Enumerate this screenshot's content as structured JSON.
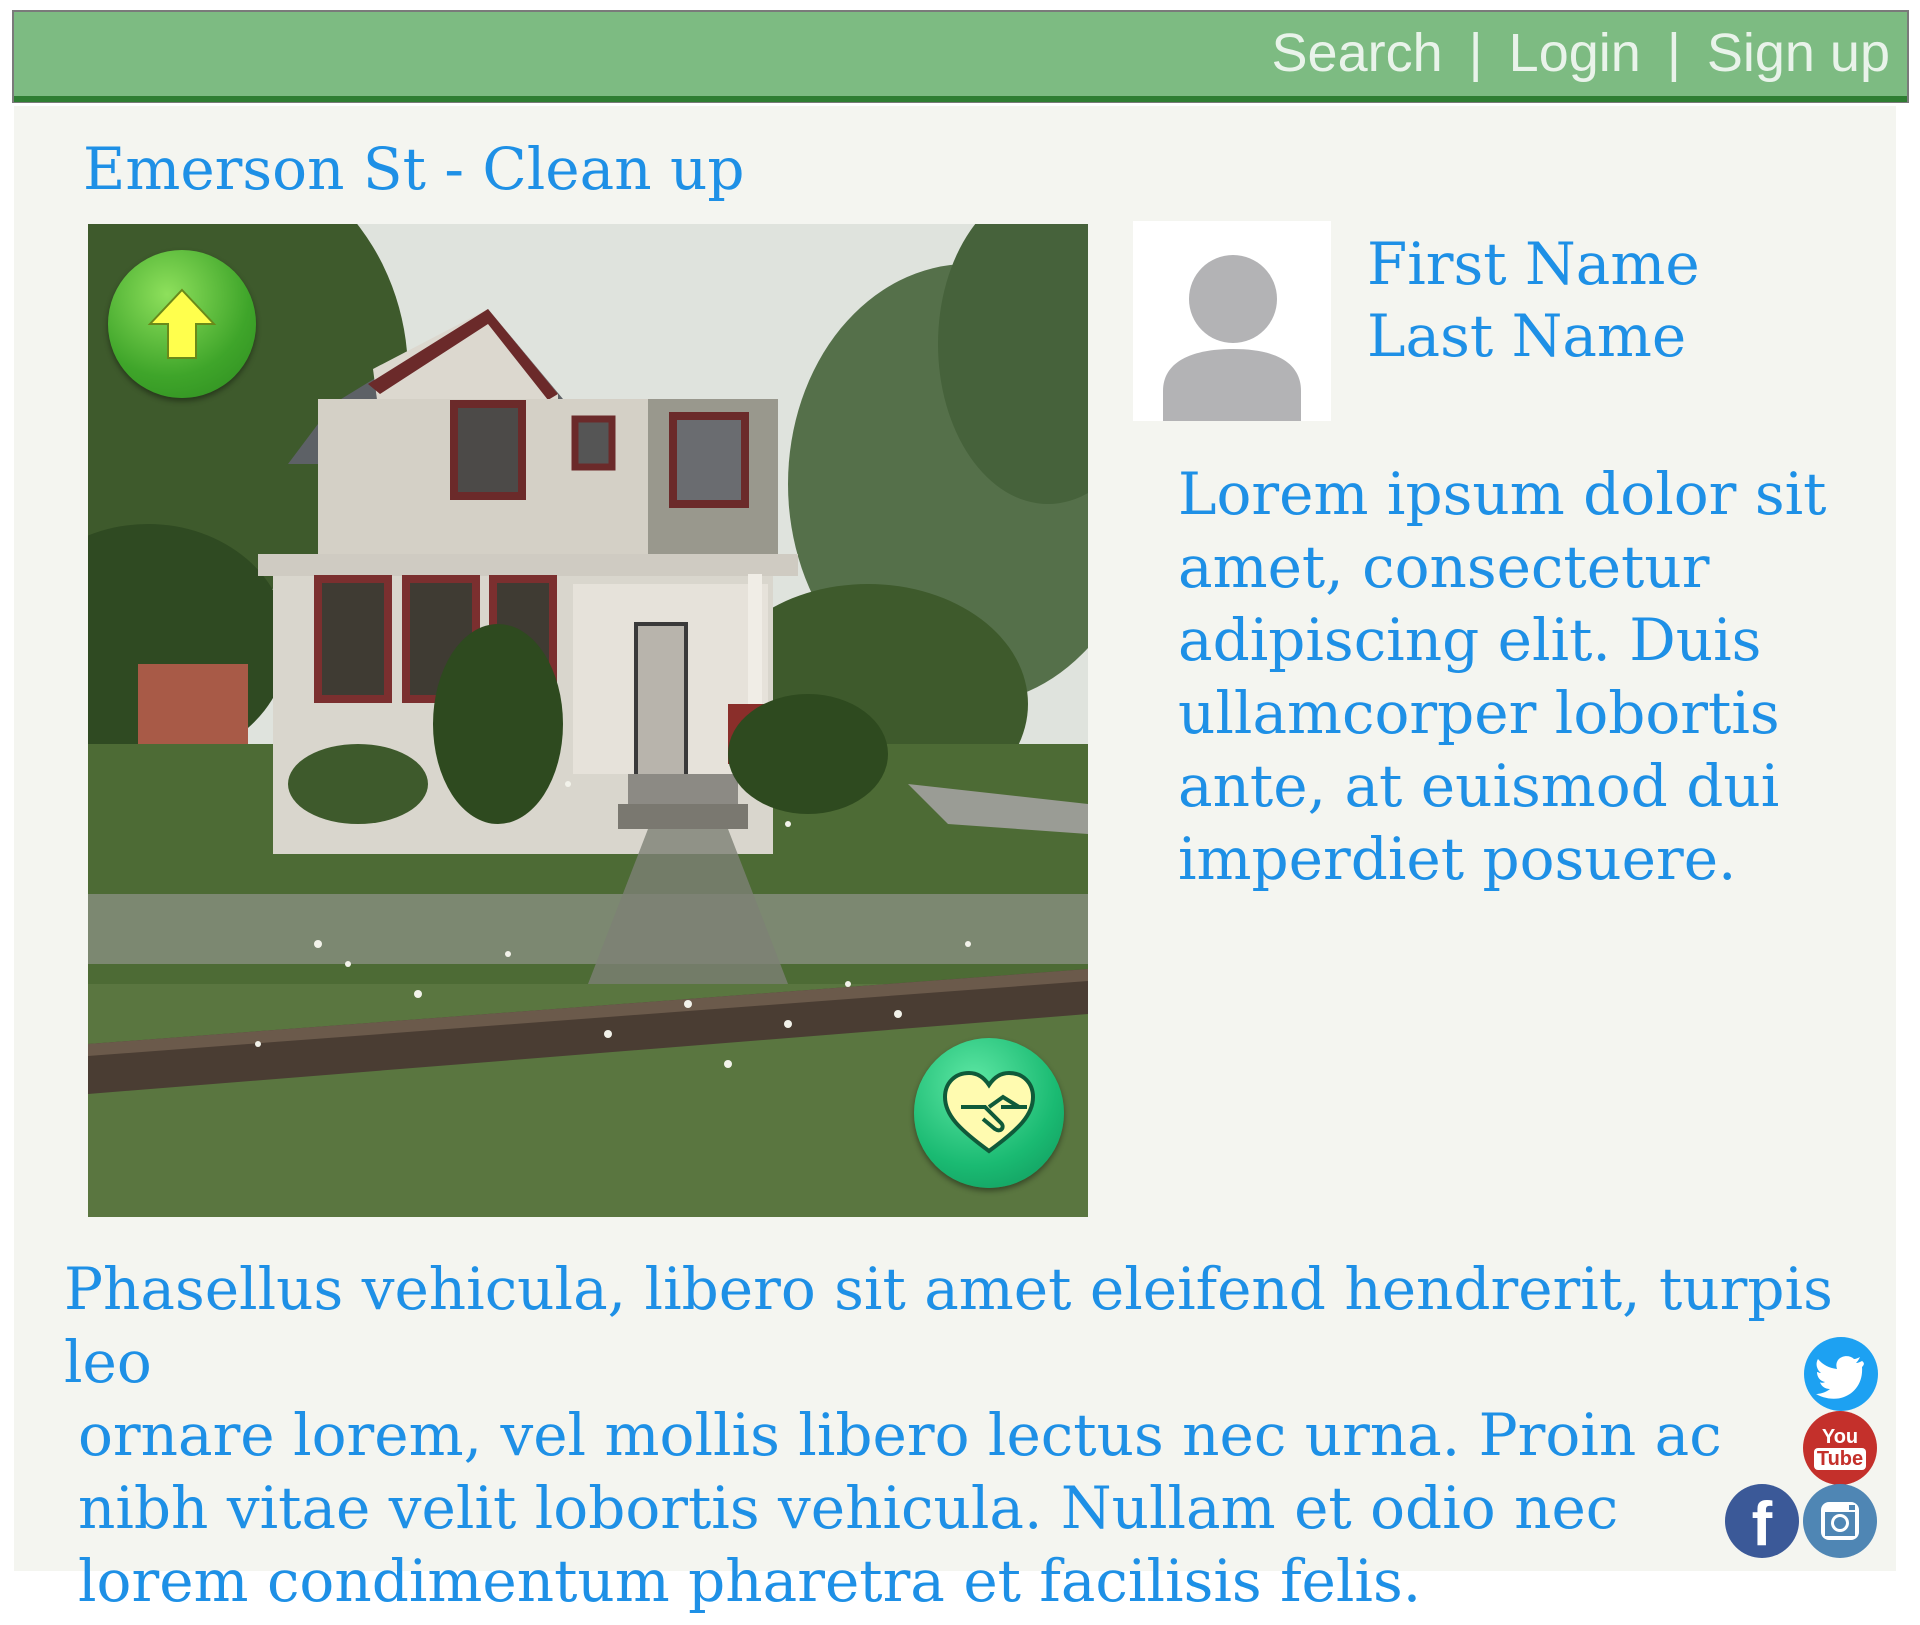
{
  "nav": {
    "search": "Search",
    "login": "Login",
    "signup": "Sign up",
    "separator": "|"
  },
  "page": {
    "title": "Emerson St - Clean up"
  },
  "photo": {
    "alt": "Abandoned house with overgrown yard"
  },
  "actions": {
    "upvote_icon": "up-arrow-icon",
    "join_icon": "heart-handshake-icon"
  },
  "profile": {
    "first_name": "First Name",
    "last_name": "Last Name",
    "avatar_icon": "user-silhouette-icon"
  },
  "description": "Lorem ipsum dolor sit amet, consectetur adipiscing elit. Duis ullamcorper lobortis ante, at euismod dui imperdiet posuere.",
  "body": {
    "line1": "Phasellus vehicula, libero sit amet eleifend hendrerit, turpis leo",
    "rest": "ornare lorem, vel mollis libero lectus nec urna. Proin ac nibh vitae velit lobortis vehicula. Nullam et odio nec lorem condimentum pharetra et facilisis felis."
  },
  "social": {
    "twitter": "twitter-icon",
    "youtube_line1": "You",
    "youtube_line2": "Tube",
    "facebook": "f",
    "instagram": "instagram-icon"
  },
  "colors": {
    "topbar": "#7dbb82",
    "topbar_line": "#2e7d32",
    "text_blue": "#1e90e6",
    "panel_bg": "#f4f5f0",
    "upvote_green": "#3fa52a",
    "upvote_arrow": "#ffff4d",
    "join_green": "#1aba72"
  }
}
